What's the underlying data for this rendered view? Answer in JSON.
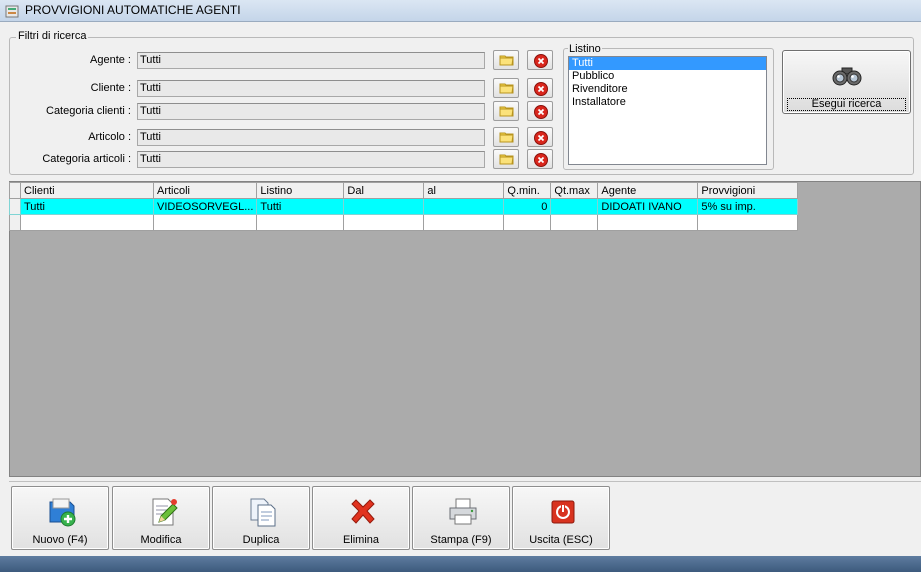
{
  "window": {
    "title": "PROVVIGIONI AUTOMATICHE AGENTI"
  },
  "filters": {
    "group_title": "Filtri di ricerca",
    "agente_label": "Agente :",
    "agente_value": "Tutti",
    "cliente_label": "Cliente :",
    "cliente_value": "Tutti",
    "categoria_clienti_label": "Categoria clienti :",
    "categoria_clienti_value": "Tutti",
    "articolo_label": "Articolo :",
    "articolo_value": "Tutti",
    "categoria_articoli_label": "Categoria articoli :",
    "categoria_articoli_value": "Tutti"
  },
  "listino": {
    "title": "Listino",
    "items": [
      "Tutti",
      "Pubblico",
      "Rivenditore",
      "Installatore"
    ],
    "selected": "Tutti"
  },
  "search_button": {
    "label": "Esegui ricerca",
    "icon": "binoculars-icon"
  },
  "grid": {
    "columns": [
      "Clienti",
      "Articoli",
      "Listino",
      "Dal",
      "al",
      "Q.min.",
      "Qt.max",
      "Agente",
      "Provvigioni"
    ],
    "rows": [
      {
        "clienti": "Tutti",
        "articoli": "VIDEOSORVEGL...",
        "listino": "Tutti",
        "dal": "",
        "al": "",
        "qmin": "0",
        "qtmax": "",
        "agente": "DIDOATI IVANO",
        "provvigioni": "5% su imp."
      }
    ]
  },
  "toolbar": {
    "nuovo": "Nuovo (F4)",
    "modifica": "Modifica",
    "duplica": "Duplica",
    "elimina": "Elimina",
    "stampa": "Stampa (F9)",
    "uscita": "Uscita (ESC)"
  },
  "colors": {
    "selected_row": "#00ffff",
    "list_selection": "#3399ff",
    "grid_background": "#ababab"
  }
}
